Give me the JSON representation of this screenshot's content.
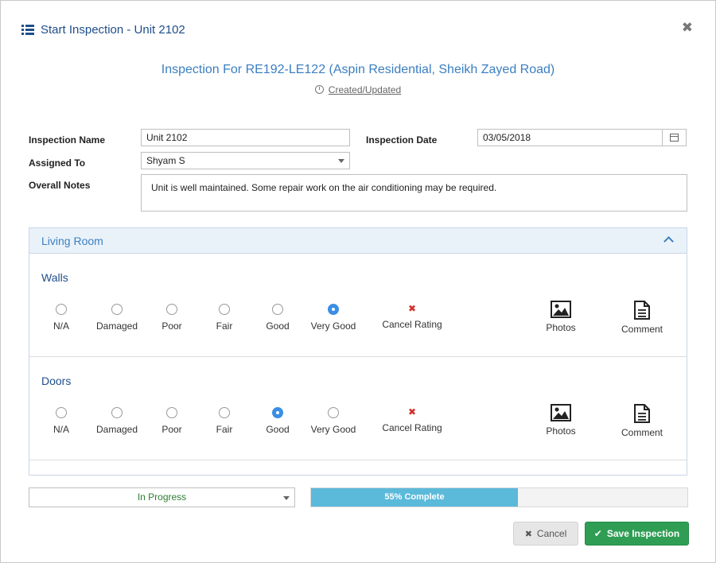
{
  "header": {
    "title": "Start Inspection - Unit 2102",
    "icon": "list-icon",
    "close_icon": "close-icon"
  },
  "inspection_for": "Inspection For RE192-LE122 (Aspin Residential, Sheikh Zayed Road)",
  "created_updated": "Created/Updated",
  "form": {
    "inspection_name_label": "Inspection Name",
    "inspection_name_value": "Unit 2102",
    "inspection_date_label": "Inspection Date",
    "inspection_date_value": "03/05/2018",
    "assigned_to_label": "Assigned To",
    "assigned_to_value": "Shyam S",
    "overall_notes_label": "Overall Notes",
    "overall_notes_value": "Unit is well maintained. Some repair work on the air conditioning may be required."
  },
  "section": {
    "title": "Living Room",
    "rating_options": [
      "N/A",
      "Damaged",
      "Poor",
      "Fair",
      "Good",
      "Very Good"
    ],
    "cancel_rating": "Cancel Rating",
    "photos_label": "Photos",
    "comment_label": "Comment",
    "items": [
      {
        "title": "Walls",
        "selected": "Very Good"
      },
      {
        "title": "Doors",
        "selected": "Good"
      }
    ]
  },
  "footer": {
    "status_value": "In Progress",
    "progress_percent": 55,
    "progress_label": "55% Complete",
    "cancel_label": "Cancel",
    "save_label": "Save Inspection"
  },
  "colors": {
    "accent": "#3a7fc1",
    "progress": "#5bb9da",
    "save": "#2f9e54",
    "status": "#2e7d32"
  }
}
